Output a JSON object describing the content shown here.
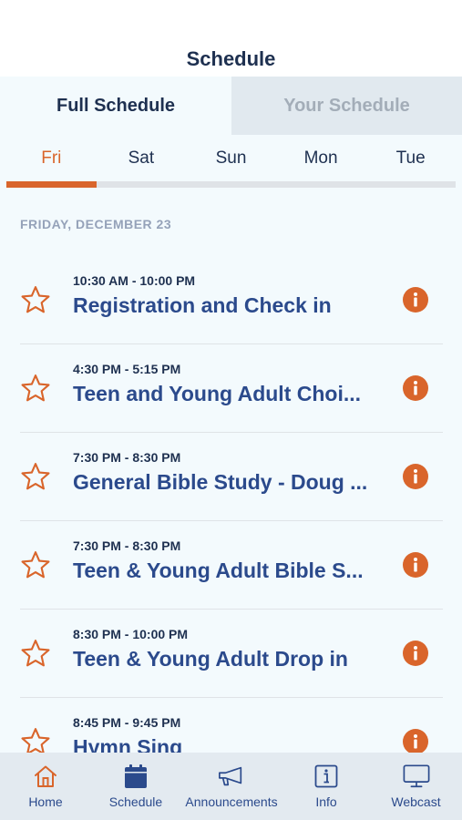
{
  "header": {
    "title": "Schedule"
  },
  "segments": [
    {
      "label": "Full Schedule",
      "active": true
    },
    {
      "label": "Your Schedule",
      "active": false
    }
  ],
  "days": [
    {
      "label": "Fri",
      "active": true
    },
    {
      "label": "Sat",
      "active": false
    },
    {
      "label": "Sun",
      "active": false
    },
    {
      "label": "Mon",
      "active": false
    },
    {
      "label": "Tue",
      "active": false
    }
  ],
  "section": {
    "date": "FRIDAY, DECEMBER 23"
  },
  "events": [
    {
      "time": "10:30 AM - 10:00 PM",
      "title": "Registration and Check in",
      "icon": "star-outline-icon"
    },
    {
      "time": "4:30 PM - 5:15 PM",
      "title": "Teen and Young Adult Choi...",
      "icon": "star-outline-icon"
    },
    {
      "time": "7:30 PM - 8:30 PM",
      "title": "General Bible Study - Doug ...",
      "icon": "star-outline-icon"
    },
    {
      "time": "7:30 PM - 8:30 PM",
      "title": "Teen & Young Adult Bible S...",
      "icon": "star-outline-icon"
    },
    {
      "time": "8:30 PM - 10:00 PM",
      "title": "Teen & Young Adult Drop in",
      "icon": "star-outline-icon"
    },
    {
      "time": "8:45 PM - 9:45 PM",
      "title": "Hymn Sing",
      "icon": "star-outline-icon"
    }
  ],
  "tabbar": [
    {
      "label": "Home",
      "icon": "home-icon"
    },
    {
      "label": "Schedule",
      "icon": "calendar-icon"
    },
    {
      "label": "Announcements",
      "icon": "megaphone-icon"
    },
    {
      "label": "Info",
      "icon": "info-box-icon"
    },
    {
      "label": "Webcast",
      "icon": "monitor-icon"
    }
  ],
  "colors": {
    "accent": "#d9652b",
    "navy": "#1e3050",
    "title_blue": "#2b4a8c",
    "background": "#f3fafd",
    "muted": "#95a2b9"
  }
}
